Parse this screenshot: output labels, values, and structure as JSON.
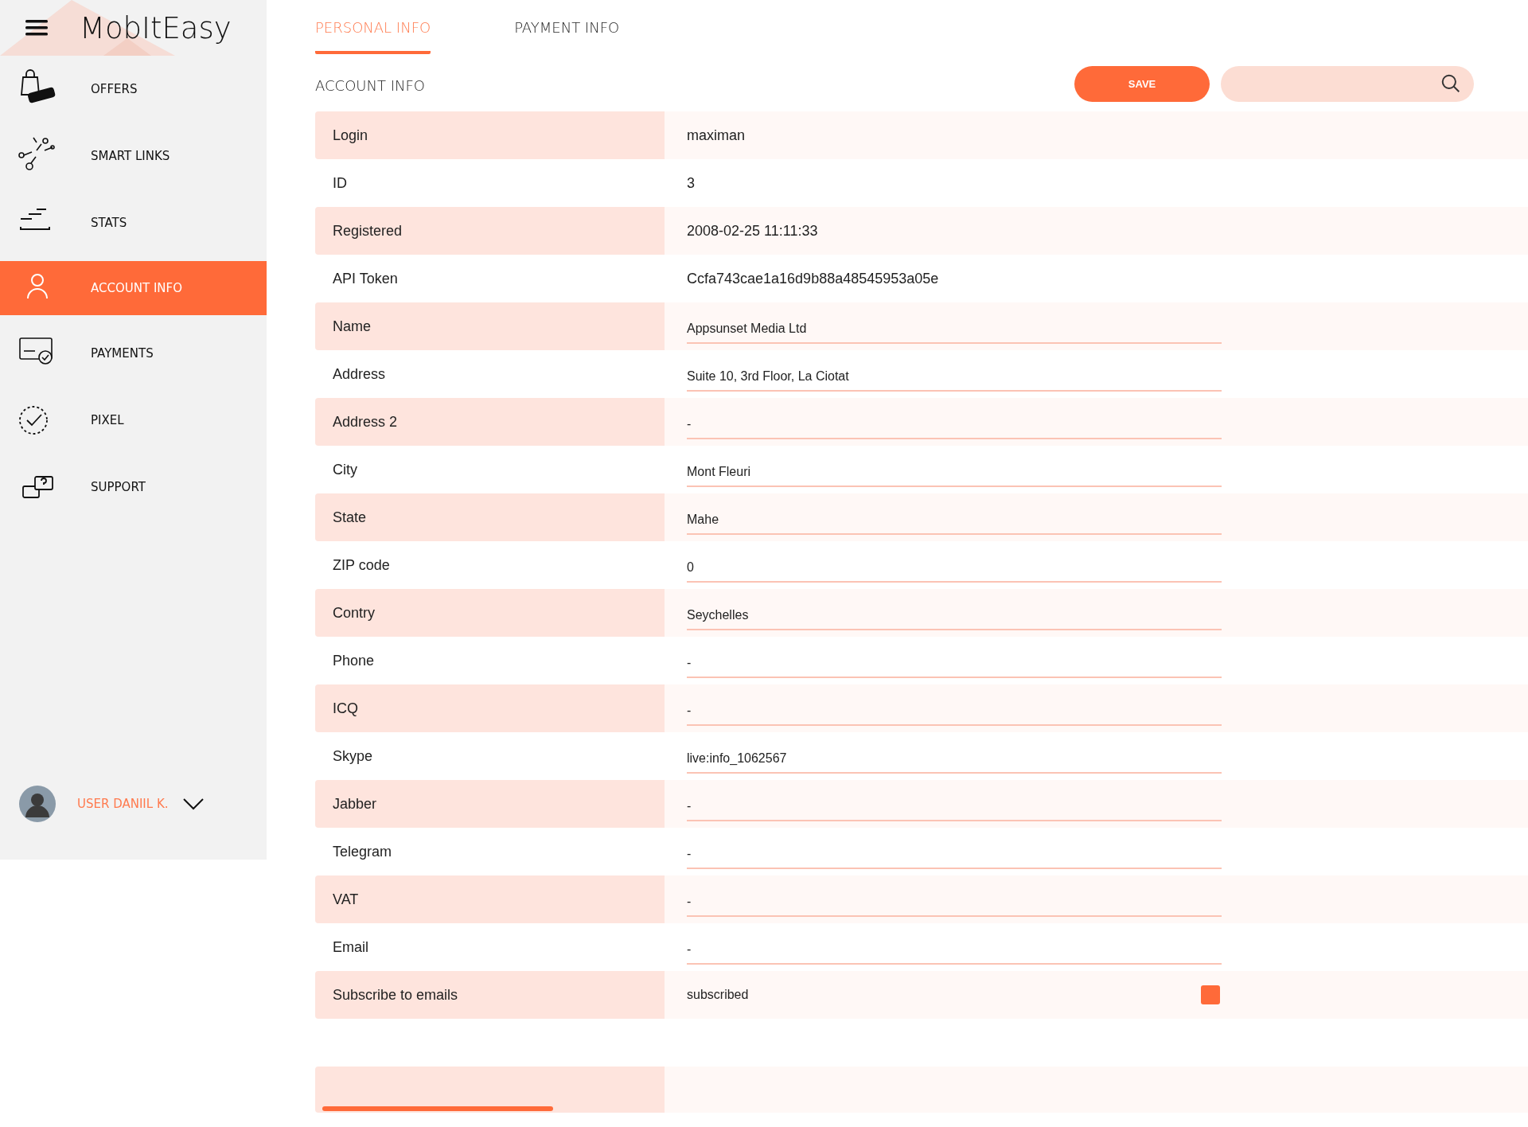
{
  "brand": "MobItEasy",
  "sidebar": {
    "items": [
      {
        "label": "OFFERS",
        "selected": false
      },
      {
        "label": "SMART LINKS",
        "selected": false
      },
      {
        "label": "STATS",
        "selected": false
      },
      {
        "label": "ACCOUNT INFO",
        "selected": true
      },
      {
        "label": "PAYMENTS",
        "selected": false
      },
      {
        "label": "PIXEL",
        "selected": false
      },
      {
        "label": "SUPPORT",
        "selected": false
      }
    ],
    "user": {
      "name": "USER DANIIL K."
    }
  },
  "tabs": [
    {
      "label": "PERSONAL INFO",
      "selected": true
    },
    {
      "label": "PAYMENT INFO",
      "selected": false
    }
  ],
  "section_title": "ACCOUNT INFO",
  "save_button": "SAVE",
  "rows": [
    {
      "kind": "text",
      "label": "Login",
      "value": "maximan"
    },
    {
      "kind": "text",
      "label": "ID",
      "value": "3"
    },
    {
      "kind": "text",
      "label": "Registered",
      "value": "2008-02-25 11:11:33"
    },
    {
      "kind": "text",
      "label": "API Token",
      "value": "Ccfa743cae1a16d9b88a48545953a05e"
    },
    {
      "kind": "field",
      "label": "Name",
      "value": "Appsunset Media Ltd"
    },
    {
      "kind": "field",
      "label": "Address",
      "value": "Suite 10, 3rd Floor, La Ciotat"
    },
    {
      "kind": "field",
      "label": "Address 2",
      "value": "-"
    },
    {
      "kind": "field",
      "label": "City",
      "value": "Mont Fleuri"
    },
    {
      "kind": "field",
      "label": "State",
      "value": "Mahe"
    },
    {
      "kind": "field",
      "label": "ZIP code",
      "value": "0"
    },
    {
      "kind": "field",
      "label": "Contry",
      "value": "Seychelles"
    },
    {
      "kind": "field",
      "label": "Phone",
      "value": "-"
    },
    {
      "kind": "field",
      "label": "ICQ",
      "value": "-"
    },
    {
      "kind": "field",
      "label": "Skype",
      "value": "live:info_1062567"
    },
    {
      "kind": "field",
      "label": "Jabber",
      "value": "-"
    },
    {
      "kind": "field",
      "label": "Telegram",
      "value": "-"
    },
    {
      "kind": "field",
      "label": "VAT",
      "value": "-"
    },
    {
      "kind": "field",
      "label": "Email",
      "value": "-"
    },
    {
      "kind": "checkbox",
      "label": "Subscribe to emails",
      "value": "subscribed",
      "checked": true
    }
  ]
}
